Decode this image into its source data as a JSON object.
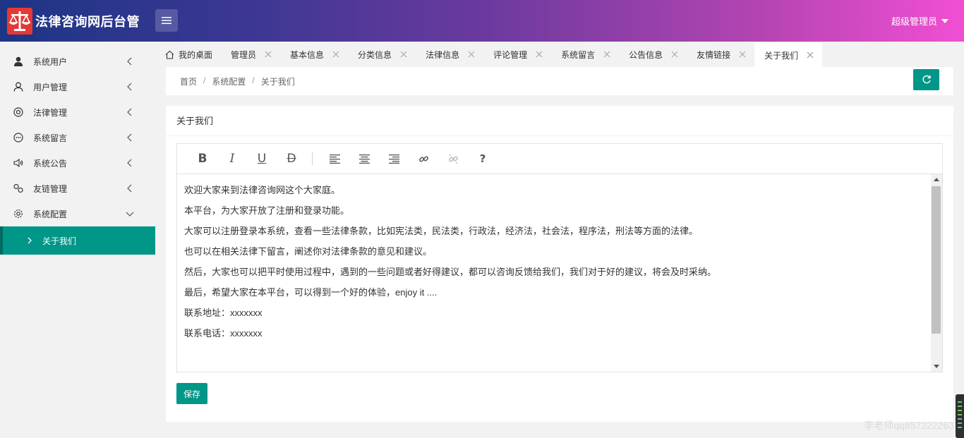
{
  "app": {
    "title": "法律咨询网后台管",
    "user": "超级管理员",
    "colors": {
      "accent": "#009688",
      "header_start": "#1d3585",
      "header_end": "#f14fd3"
    }
  },
  "sidebar": {
    "items": [
      {
        "label": "系统用户",
        "icon": "user-solid-icon"
      },
      {
        "label": "用户管理",
        "icon": "user-outline-icon"
      },
      {
        "label": "法律管理",
        "icon": "target-icon"
      },
      {
        "label": "系统留言",
        "icon": "message-icon"
      },
      {
        "label": "系统公告",
        "icon": "speaker-icon"
      },
      {
        "label": "友链管理",
        "icon": "link-icon"
      },
      {
        "label": "系统配置",
        "icon": "gear-icon",
        "expanded": true
      }
    ],
    "sub_items": [
      {
        "label": "关于我们",
        "active": true
      }
    ]
  },
  "tabs": [
    {
      "label": "我的桌面",
      "home": true
    },
    {
      "label": "管理员"
    },
    {
      "label": "基本信息"
    },
    {
      "label": "分类信息"
    },
    {
      "label": "法律信息"
    },
    {
      "label": "评论管理"
    },
    {
      "label": "系统留言"
    },
    {
      "label": "公告信息"
    },
    {
      "label": "友情链接"
    },
    {
      "label": "关于我们",
      "active": true
    }
  ],
  "breadcrumb": {
    "home": "首页",
    "section": "系统配置",
    "current": "关于我们",
    "separator": "/"
  },
  "card": {
    "title": "关于我们"
  },
  "editor": {
    "toolbar": [
      "bold-icon",
      "italic-icon",
      "underline-icon",
      "strikethrough-icon",
      "align-left-icon",
      "align-center-icon",
      "align-right-icon",
      "link-icon",
      "unlink-icon",
      "help-icon"
    ],
    "toolbar_glyphs": {
      "bold": "B",
      "italic": "I",
      "underline": "U",
      "strike": "D",
      "help": "?"
    },
    "lines": [
      "欢迎大家来到法律咨询网这个大家庭。",
      "本平台，为大家开放了注册和登录功能。",
      "大家可以注册登录本系统，查看一些法律条款，比如宪法类，民法类，行政法，经济法，社会法，程序法，刑法等方面的法律。",
      "也可以在相关法律下留言，阐述你对法律条款的意见和建议。",
      "然后，大家也可以把平时使用过程中，遇到的一些问题或者好得建议，都可以咨询反馈给我们，我们对于好的建议，将会及时采纳。",
      "最后，希望大家在本平台，可以得到一个好的体验，enjoy it ....",
      "联系地址：xxxxxxx",
      "联系电话：xxxxxxx"
    ]
  },
  "actions": {
    "save": "保存"
  },
  "watermark": "李老师qq857222263"
}
